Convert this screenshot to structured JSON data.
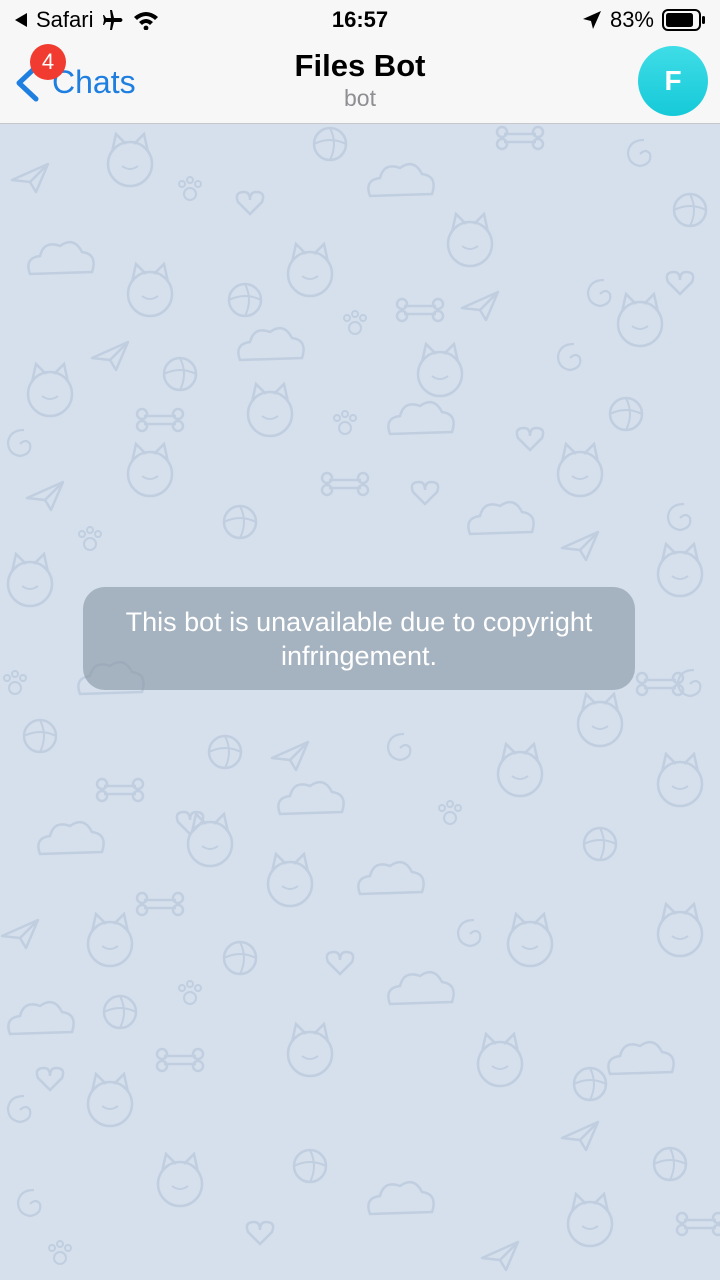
{
  "status_bar": {
    "back_app": "Safari",
    "time": "16:57",
    "battery": "83%"
  },
  "nav": {
    "back_label": "Chats",
    "unread_count": "4",
    "title": "Files Bot",
    "subtitle": "bot",
    "avatar_letter": "F"
  },
  "chat": {
    "notice": "This bot is unavailable due to copyright infringement."
  },
  "colors": {
    "accent": "#1e7fe0",
    "badge": "#f23b30",
    "avatar": "#22d0de",
    "chat_background": "#d5e0ec"
  },
  "icons": {
    "back_app": "triangle-left-icon",
    "airplane": "airplane-icon",
    "wifi": "wifi-icon",
    "location": "location-arrow-icon",
    "battery": "battery-icon",
    "back": "chevron-left-icon"
  }
}
